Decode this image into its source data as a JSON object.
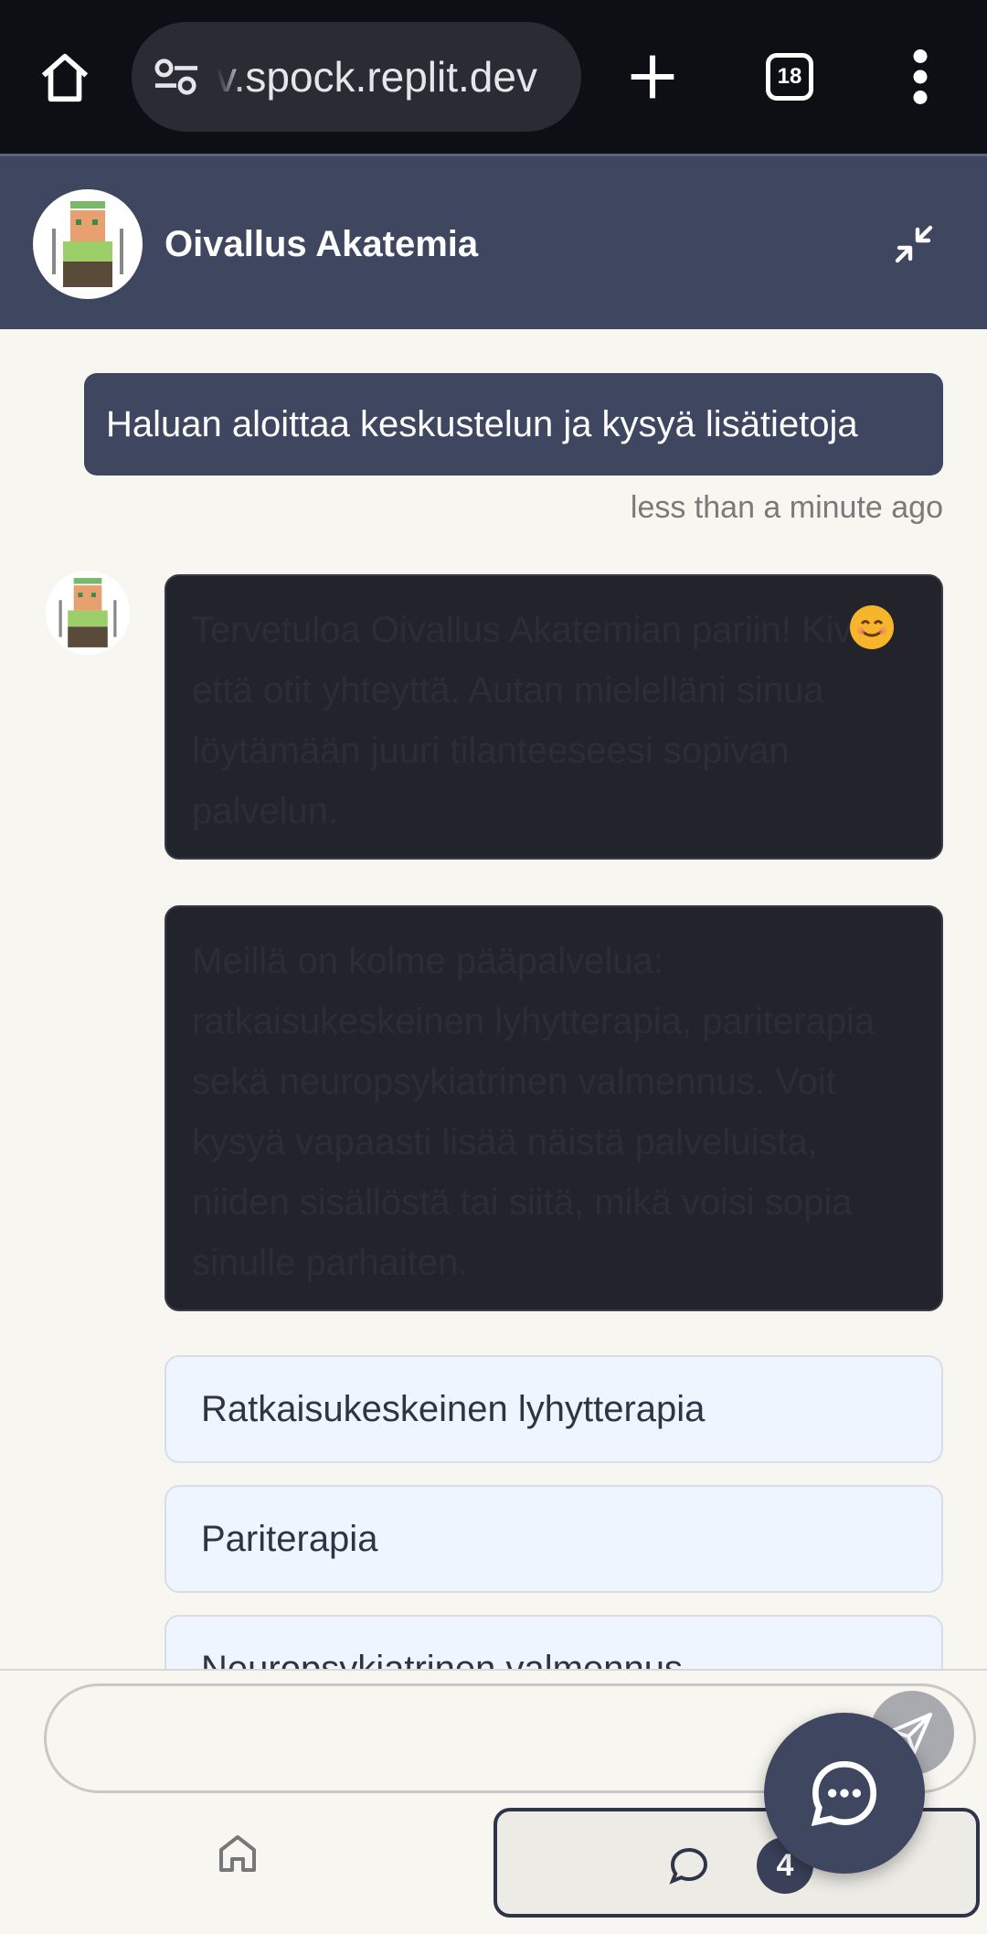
{
  "browser": {
    "url": "v.spock.replit.dev",
    "tab_count": "18"
  },
  "header": {
    "title": "Oivallus Akatemia"
  },
  "messages": {
    "user_message": "Haluan aloittaa keskustelun ja kysyä lisätietoja",
    "user_timestamp": "less than a minute ago",
    "bot_message_1": "Tervetuloa Oivallus Akatemian pariin! Kiva, että otit yhteyttä. Autan mielelläni sinua löytämään juuri tilanteeseesi sopivan palvelun.",
    "bot_message_1_emoji": "😊",
    "bot_message_2": "Meillä on kolme pääpalvelua: ratkaisukeskeinen lyhytterapia, pariterapia sekä neuropsykiatrinen valmennus. Voit kysyä vapaasti lisää näistä palveluista, niiden sisällöstä tai siitä, mikä voisi sopia sinulle parhaiten."
  },
  "options": [
    {
      "label": "Ratkaisukeskeinen lyhytterapia"
    },
    {
      "label": "Pariterapia"
    },
    {
      "label": "Neuropsykiatrinen valmennus"
    }
  ],
  "input": {
    "placeholder": ""
  },
  "bottom_nav": {
    "chat_badge": "4"
  },
  "colors": {
    "header_bg": "#3e4660",
    "background": "#f8f6f0",
    "option_bg": "#eef5fe",
    "bot_bubble_bg": "#22232b"
  },
  "icons": [
    "home-icon",
    "tune-icon",
    "plus-icon",
    "tabs-icon",
    "more-vert-icon",
    "minimize-icon",
    "send-icon",
    "chat-bubble-icon",
    "chat-fab-icon"
  ]
}
